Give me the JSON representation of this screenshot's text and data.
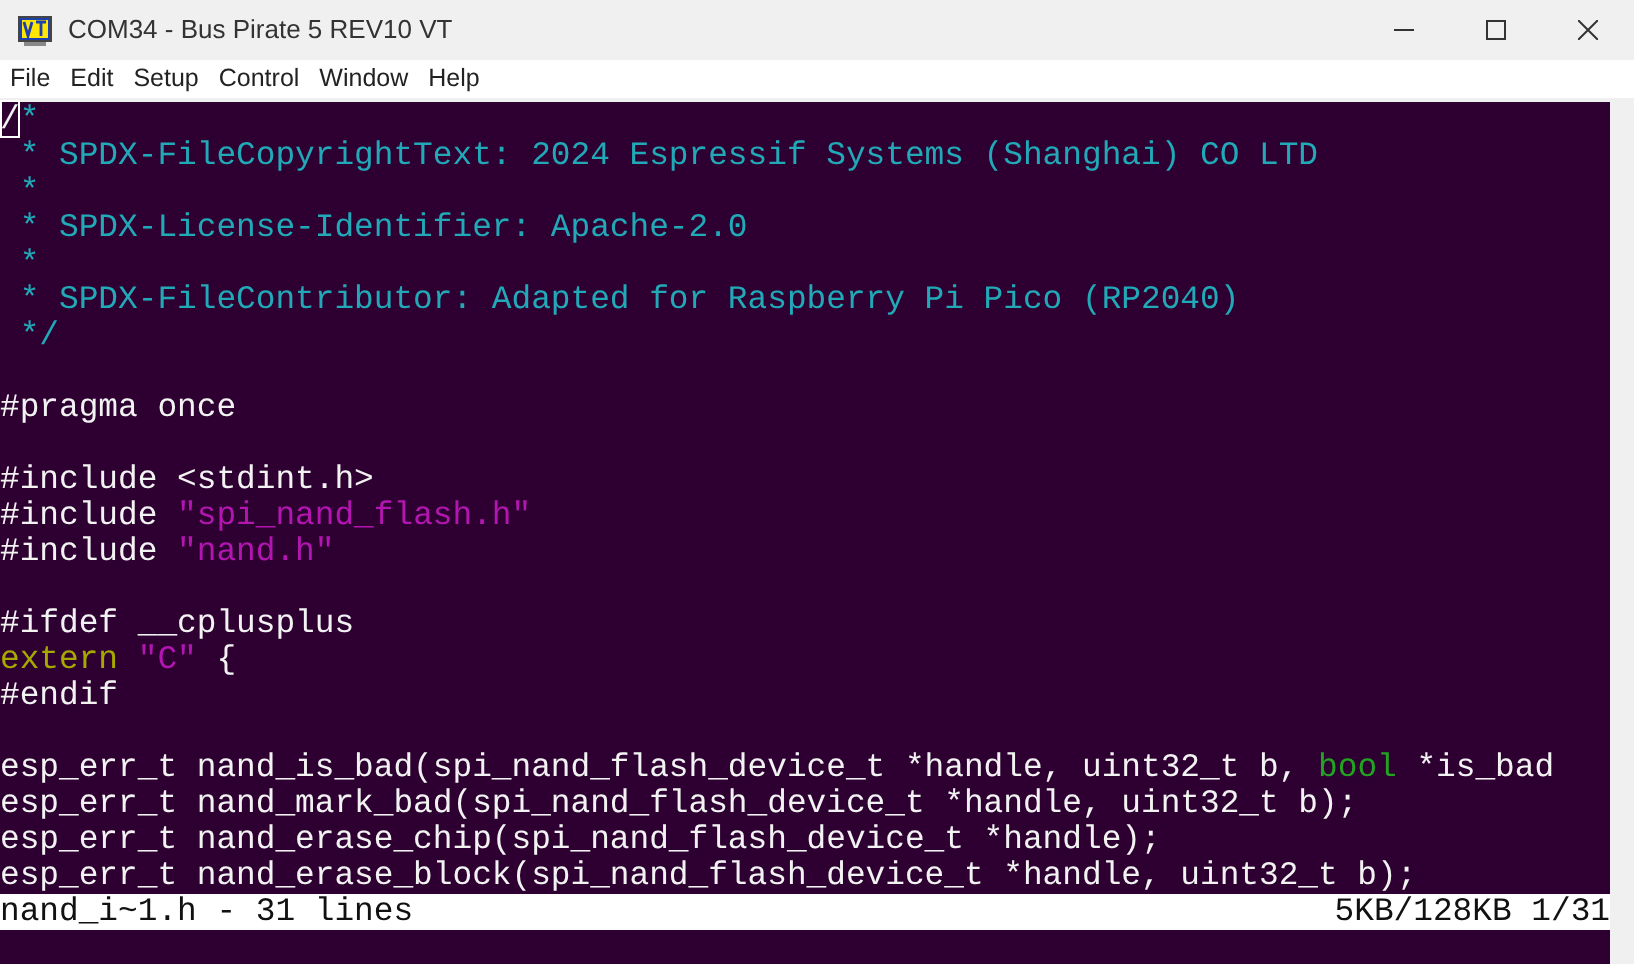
{
  "window": {
    "title": "COM34 - Bus Pirate 5 REV10 VT"
  },
  "menu": [
    "File",
    "Edit",
    "Setup",
    "Control",
    "Window",
    "Help"
  ],
  "terminal": {
    "lines": [
      {
        "kind": "code",
        "segments": [
          {
            "text": "/",
            "kind": "cursor"
          },
          {
            "text": "*",
            "kind": "comment"
          }
        ]
      },
      {
        "kind": "code",
        "segments": [
          {
            "text": " * SPDX-FileCopyrightText: 2024 Espressif Systems (Shanghai) CO LTD",
            "kind": "comment"
          }
        ]
      },
      {
        "kind": "code",
        "segments": [
          {
            "text": " *",
            "kind": "comment"
          }
        ]
      },
      {
        "kind": "code",
        "segments": [
          {
            "text": " * SPDX-License-Identifier: Apache-2.0",
            "kind": "comment"
          }
        ]
      },
      {
        "kind": "code",
        "segments": [
          {
            "text": " *",
            "kind": "comment"
          }
        ]
      },
      {
        "kind": "code",
        "segments": [
          {
            "text": " * SPDX-FileContributor: Adapted for Raspberry Pi Pico (RP2040)",
            "kind": "comment"
          }
        ]
      },
      {
        "kind": "code",
        "segments": [
          {
            "text": " */",
            "kind": "comment"
          }
        ]
      },
      {
        "kind": "blank"
      },
      {
        "kind": "code",
        "segments": [
          {
            "text": "#pragma once",
            "kind": "plain"
          }
        ]
      },
      {
        "kind": "blank"
      },
      {
        "kind": "code",
        "segments": [
          {
            "text": "#include <stdint.h>",
            "kind": "plain"
          }
        ]
      },
      {
        "kind": "code",
        "segments": [
          {
            "text": "#include ",
            "kind": "plain"
          },
          {
            "text": "\"spi_nand_flash.h\"",
            "kind": "string"
          }
        ]
      },
      {
        "kind": "code",
        "segments": [
          {
            "text": "#include ",
            "kind": "plain"
          },
          {
            "text": "\"nand.h\"",
            "kind": "string"
          }
        ]
      },
      {
        "kind": "blank"
      },
      {
        "kind": "code",
        "segments": [
          {
            "text": "#ifdef __cplusplus",
            "kind": "plain"
          }
        ]
      },
      {
        "kind": "code",
        "segments": [
          {
            "text": "extern",
            "kind": "keyword"
          },
          {
            "text": " \"C\"",
            "kind": "string"
          },
          {
            "text": " {",
            "kind": "plain"
          }
        ]
      },
      {
        "kind": "code",
        "segments": [
          {
            "text": "#endif",
            "kind": "plain"
          }
        ]
      },
      {
        "kind": "blank"
      },
      {
        "kind": "code",
        "segments": [
          {
            "text": "esp_err_t nand_is_bad(spi_nand_flash_device_t *handle, uint32_t b, ",
            "kind": "plain"
          },
          {
            "text": "bool",
            "kind": "type"
          },
          {
            "text": " *is_bad",
            "kind": "plain"
          }
        ]
      },
      {
        "kind": "code",
        "segments": [
          {
            "text": "esp_err_t nand_mark_bad(spi_nand_flash_device_t *handle, uint32_t b);",
            "kind": "plain"
          }
        ]
      },
      {
        "kind": "code",
        "segments": [
          {
            "text": "esp_err_t nand_erase_chip(spi_nand_flash_device_t *handle);",
            "kind": "plain"
          }
        ]
      },
      {
        "kind": "code",
        "segments": [
          {
            "text": "esp_err_t nand_erase_block(spi_nand_flash_device_t *handle, uint32_t b);",
            "kind": "plain"
          }
        ]
      }
    ]
  },
  "status_bar": {
    "left": "nand_i~1.h - 31 lines",
    "right": "5KB/128KB 1/31"
  }
}
